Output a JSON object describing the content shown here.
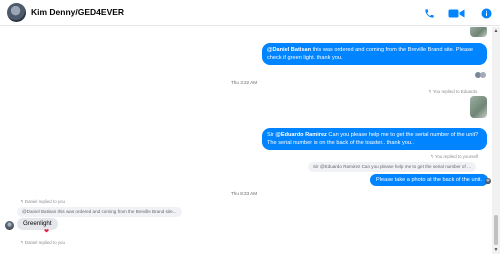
{
  "header": {
    "title": "Kim Denny/GED4EVER",
    "icons": [
      "phone-icon",
      "video-camera-icon",
      "info-icon"
    ],
    "accent": "#0084ff"
  },
  "messages": {
    "msg1": {
      "mention": "@Daniel Batisan",
      "text": " this was ordered and coming from the Breville Brand site. Please check if green light. thank you."
    },
    "time1": "Thu 3:32 AM",
    "reply_meta1": "You replied to Eduardo",
    "msg2": {
      "prefix": "Sir ",
      "mention": "@Eduardo Ramirez",
      "text": " Can you please help me to get the serial number of the unit? The serial number is on the back of the toaster.. thank you.."
    },
    "reply_meta2": "You replied to yourself",
    "quote2": "Sir @Eduardo Ramirez Can you please help me to get the serial number of ...",
    "msg3": "Please take a photo at the back of the unit.",
    "time2": "Thu 8:33 AM",
    "reply_meta3": "Daniel replied to you",
    "quote3": "@Daniel Batisan this was ordered and coming from the Breville Brand site...",
    "msg4": "Greenlight",
    "reaction": "❤",
    "reply_meta4": "Daniel replied to you"
  },
  "colors": {
    "outgoing_bubble": "#0084ff",
    "incoming_bubble": "#e4e6eb"
  }
}
